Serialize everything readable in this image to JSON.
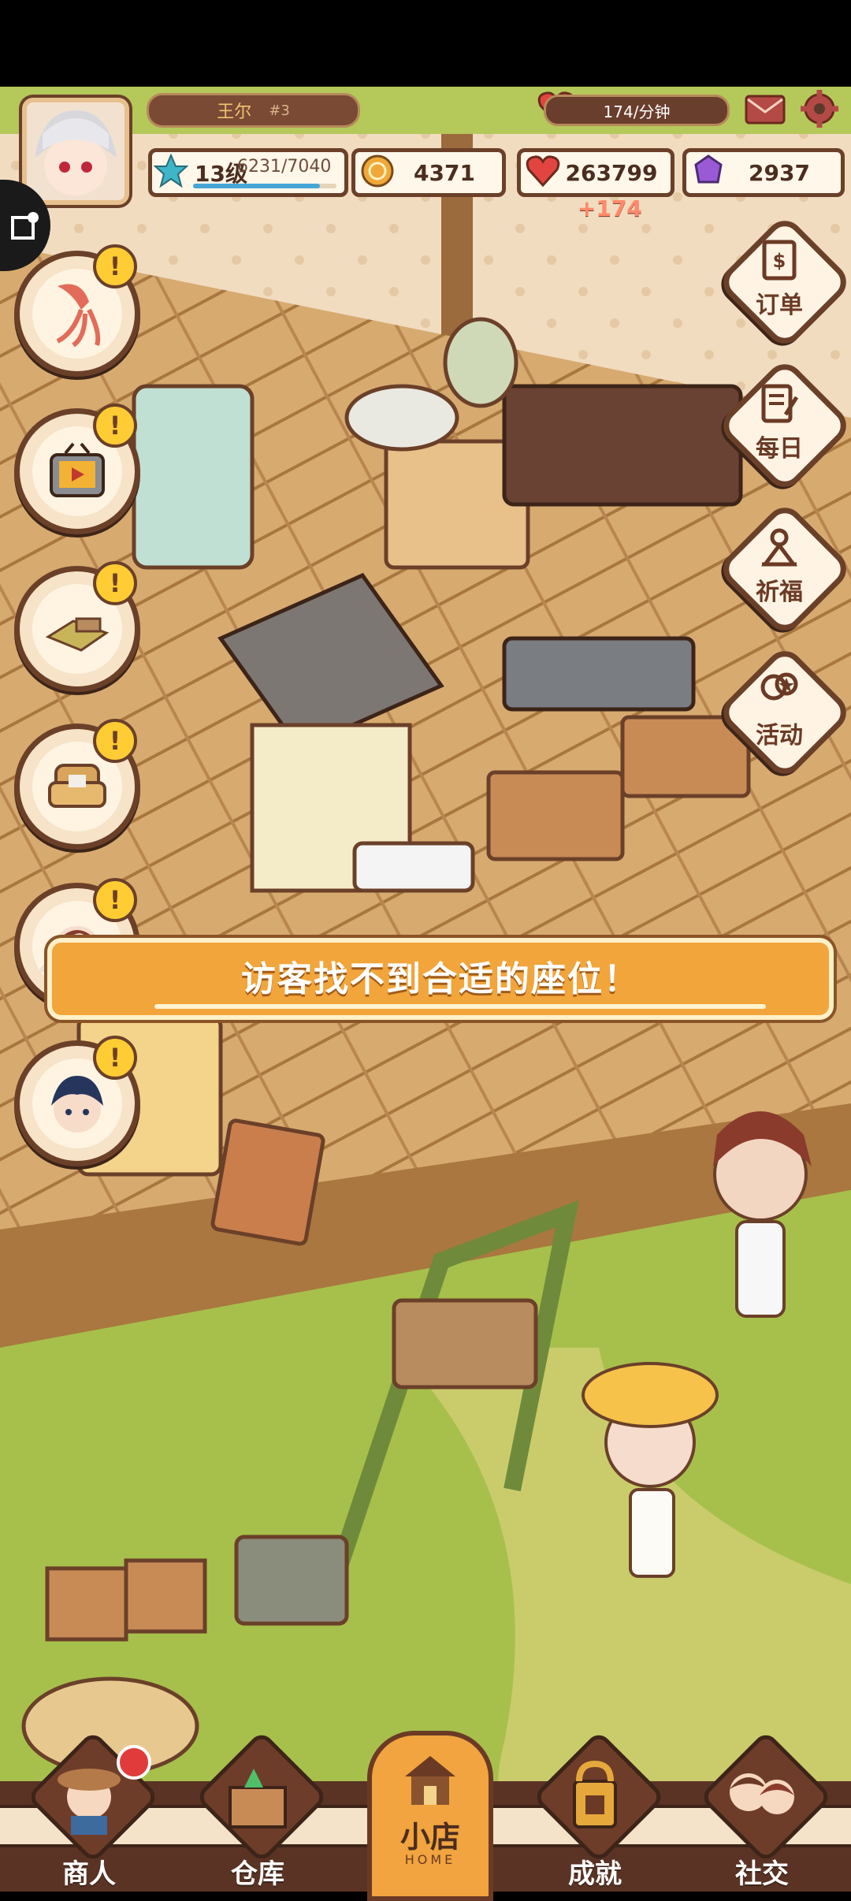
{
  "hud": {
    "player_name": "王尔",
    "player_tag": "#3",
    "rate_text": "174/分钟",
    "level_text": "13级",
    "xp_text": "6231/7040",
    "xp_progress": 0.885,
    "coins": "4371",
    "hearts": "263799",
    "gems": "2937",
    "gain_text": "+174"
  },
  "side_left": [
    {
      "name": "squid",
      "alert": "!"
    },
    {
      "name": "tv",
      "alert": "!"
    },
    {
      "name": "rug",
      "alert": "!"
    },
    {
      "name": "armchair",
      "alert": "!"
    },
    {
      "name": "visitor",
      "alert": "!"
    },
    {
      "name": "boy",
      "alert": "!"
    }
  ],
  "side_right": [
    {
      "label": "订单",
      "icon": "order-icon"
    },
    {
      "label": "每日",
      "icon": "daily-icon"
    },
    {
      "label": "祈福",
      "icon": "pray-icon"
    },
    {
      "label": "活动",
      "icon": "event-icon"
    }
  ],
  "banner": {
    "text": "访客找不到合适的座位！"
  },
  "nav": {
    "merchant": "商人",
    "warehouse": "仓库",
    "shop": "小店",
    "shop_sub": "HOME",
    "achievement": "成就",
    "social": "社交"
  },
  "colors": {
    "brown": "#6b4029",
    "cream": "#fff4e2",
    "orange": "#f2a53a"
  }
}
